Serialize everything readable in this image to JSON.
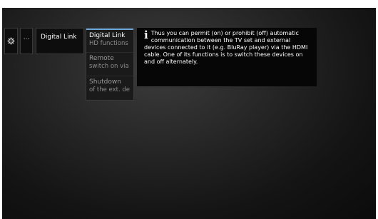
{
  "breadcrumb": {
    "settings_icon": "gear-icon",
    "ellipsis": "...",
    "current": "Digital Link"
  },
  "submenu": {
    "items": [
      {
        "title": "Digital Link",
        "subtitle": "HD functions"
      },
      {
        "title": "Remote",
        "subtitle": "switch on via"
      },
      {
        "title": "Shutdown",
        "subtitle": "of the ext. de"
      }
    ]
  },
  "info_panel": {
    "icon": "info-icon",
    "text": "Thus you can permit (on) or prohibit (off) automatic communication between the TV set and external devices connected to it (e.g. BluRay player) via the HDMI cable.  One of its functions is to switch these devices on and off alternately."
  },
  "colors": {
    "selection_accent": "#6aa6d9",
    "background_dark": "#0b0b0b"
  }
}
